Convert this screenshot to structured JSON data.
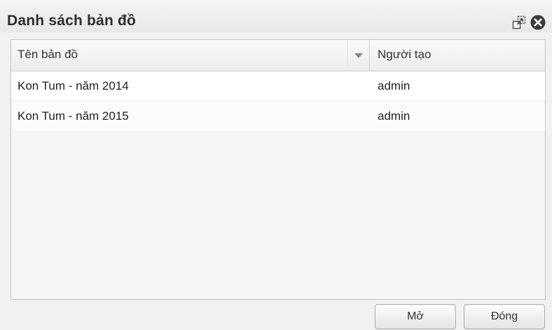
{
  "dialog": {
    "title": "Danh sách bản đồ"
  },
  "icons": {
    "maximize": "maximize-icon",
    "close": "close-icon"
  },
  "grid": {
    "columns": [
      "Tên bản đồ",
      "Người tạo"
    ],
    "sort_icon": "sort-down-icon",
    "rows": [
      {
        "name": "Kon Tum - năm 2014",
        "owner": "admin"
      },
      {
        "name": "Kon Tum - năm 2015",
        "owner": "admin"
      }
    ]
  },
  "buttons": {
    "open_label": "Mở",
    "close_label": "Đóng"
  }
}
